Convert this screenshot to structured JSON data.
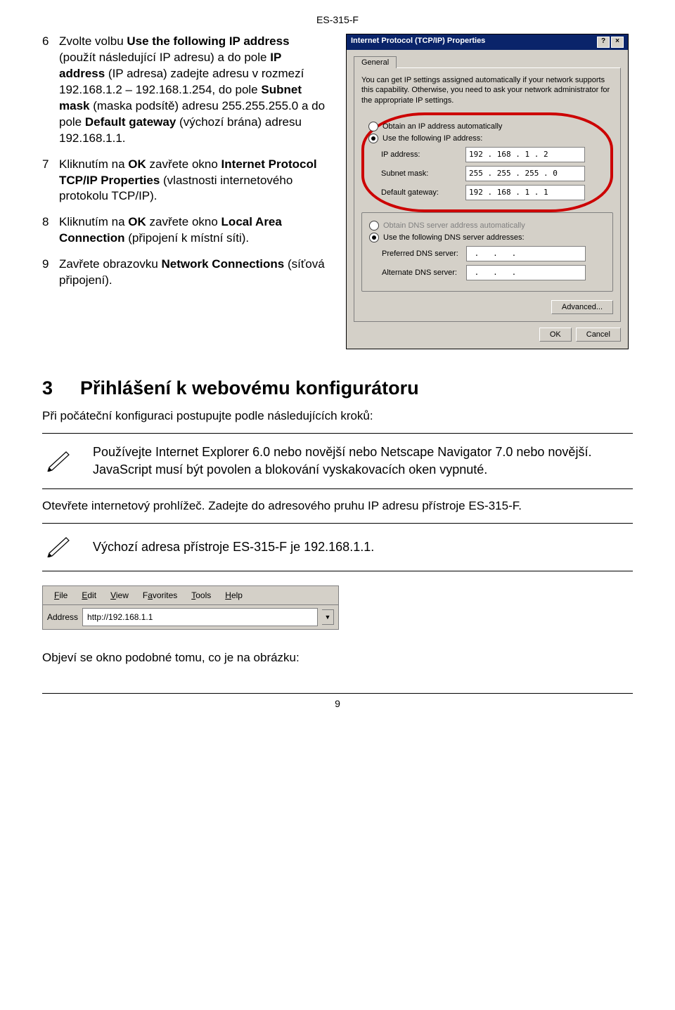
{
  "header": {
    "doc_id": "ES-315-F"
  },
  "steps": [
    {
      "num": "6",
      "parts": [
        {
          "t": "Zvolte volbu "
        },
        {
          "t": "Use the following IP address",
          "b": true
        },
        {
          "t": " (použít následující IP adresu) a do pole "
        },
        {
          "t": "IP address",
          "b": true
        },
        {
          "t": " (IP adresa) zadejte adresu v rozmezí 192.168.1.2 – 192.168.1.254, do pole "
        },
        {
          "t": "Subnet mask",
          "b": true
        },
        {
          "t": " (maska podsítě) adresu 255.255.255.0 a do pole "
        },
        {
          "t": "Default gateway",
          "b": true
        },
        {
          "t": " (výchozí brána) adresu 192.168.1.1."
        }
      ]
    },
    {
      "num": "7",
      "parts": [
        {
          "t": "Kliknutím na "
        },
        {
          "t": "OK",
          "b": true
        },
        {
          "t": " zavřete okno "
        },
        {
          "t": "Internet Protocol TCP/IP Properties",
          "b": true
        },
        {
          "t": " (vlastnosti internetového protokolu TCP/IP)."
        }
      ]
    },
    {
      "num": "8",
      "parts": [
        {
          "t": "Kliknutím na "
        },
        {
          "t": "OK",
          "b": true
        },
        {
          "t": " zavřete okno "
        },
        {
          "t": "Local Area Connection",
          "b": true
        },
        {
          "t": " (připojení k místní síti)."
        }
      ]
    },
    {
      "num": "9",
      "parts": [
        {
          "t": "Zavřete obrazovku "
        },
        {
          "t": "Network Connections",
          "b": true
        },
        {
          "t": " (síťová připojení)."
        }
      ]
    }
  ],
  "dialog": {
    "title": "Internet Protocol (TCP/IP) Properties",
    "tab": "General",
    "desc": "You can get IP settings assigned automatically if your network supports this capability. Otherwise, you need to ask your network administrator for the appropriate IP settings.",
    "r_auto_ip": "Obtain an IP address automatically",
    "r_use_ip": "Use the following IP address:",
    "lbl_ip": "IP address:",
    "val_ip": "192 . 168 .  1  .  2",
    "lbl_mask": "Subnet mask:",
    "val_mask": "255 . 255 . 255 .  0",
    "lbl_gw": "Default gateway:",
    "val_gw": "192 . 168 .  1  .  1",
    "r_auto_dns": "Obtain DNS server address automatically",
    "r_use_dns": "Use the following DNS server addresses:",
    "lbl_pdns": "Preferred DNS server:",
    "lbl_adns": "Alternate DNS server:",
    "btn_adv": "Advanced...",
    "btn_ok": "OK",
    "btn_cancel": "Cancel",
    "help_glyph": "?",
    "close_glyph": "×"
  },
  "section3": {
    "num": "3",
    "title": "Přihlášení k webovému konfigurátoru",
    "intro": "Při počáteční konfiguraci postupujte podle následujících kroků:",
    "note1": "Používejte Internet Explorer 6.0 nebo novější nebo Netscape Navigator 7.0 nebo novější. JavaScript musí být povolen a blokování vyskakovacích oken vypnuté.",
    "open_browser": "Otevřete internetový prohlížeč. Zadejte do adresového pruhu IP adresu přístroje ES-315-F.",
    "note2": "Výchozí adresa přístroje ES-315-F je 192.168.1.1."
  },
  "browser": {
    "menu": {
      "file": {
        "u": "F",
        "rest": "ile"
      },
      "edit": {
        "u": "E",
        "rest": "dit"
      },
      "view": {
        "u": "V",
        "rest": "iew"
      },
      "fav": {
        "pre": "F",
        "u": "a",
        "rest": "vorites"
      },
      "tools": {
        "u": "T",
        "rest": "ools"
      },
      "help": {
        "u": "H",
        "rest": "elp"
      }
    },
    "addr_label": "Address",
    "addr_value": "http://192.168.1.1",
    "drop_glyph": "▼"
  },
  "closing": "Objeví se okno podobné tomu, co je na obrázku:",
  "footer": {
    "page": "9"
  },
  "icons": {
    "hand_write": "✍"
  }
}
